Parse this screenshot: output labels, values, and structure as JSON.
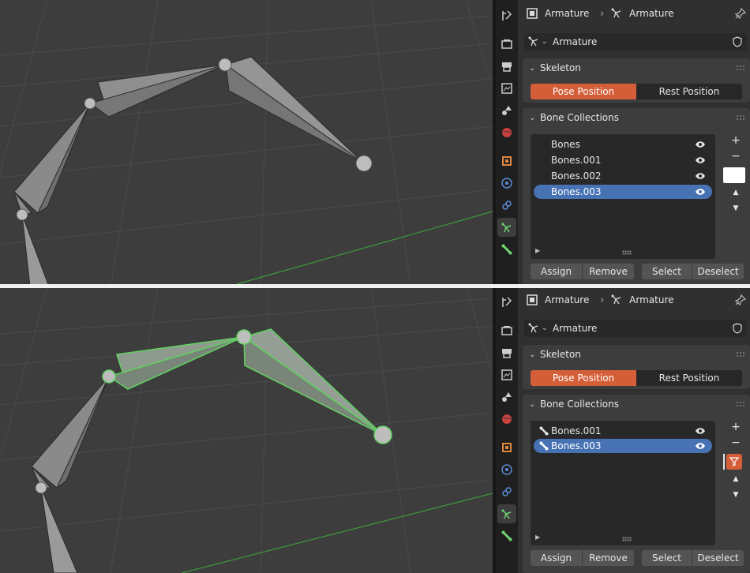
{
  "top": {
    "header": {
      "breadcrumb_object": "Armature",
      "breadcrumb_data": "Armature"
    },
    "datablock": {
      "name": "Armature"
    },
    "skeleton": {
      "title": "Skeleton",
      "pose_position": "Pose Position",
      "rest_position": "Rest Position"
    },
    "bone_collections": {
      "title": "Bone Collections",
      "items": [
        {
          "label": "Bones",
          "selected": false
        },
        {
          "label": "Bones.001",
          "selected": false
        },
        {
          "label": "Bones.002",
          "selected": false
        },
        {
          "label": "Bones.003",
          "selected": true
        }
      ],
      "add": "+",
      "remove": "−",
      "up": "▲",
      "down": "▼"
    },
    "buttons": {
      "assign": "Assign",
      "remove": "Remove",
      "select": "Select",
      "deselect": "Deselect"
    }
  },
  "bottom": {
    "header": {
      "breadcrumb_object": "Armature",
      "breadcrumb_data": "Armature"
    },
    "datablock": {
      "name": "Armature"
    },
    "skeleton": {
      "title": "Skeleton",
      "pose_position": "Pose Position",
      "rest_position": "Rest Position"
    },
    "bone_collections": {
      "title": "Bone Collections",
      "items": [
        {
          "label": "Bones.001",
          "selected": false
        },
        {
          "label": "Bones.003",
          "selected": true
        }
      ],
      "add": "+",
      "remove": "−",
      "up": "▲",
      "down": "▼"
    },
    "buttons": {
      "assign": "Assign",
      "remove": "Remove",
      "select": "Select",
      "deselect": "Deselect"
    }
  },
  "colors": {
    "accent_orange": "#d35e37",
    "selection_blue": "#4772b3",
    "bone_select_green": "#5fd35f",
    "grid_green": "#3c9a3c"
  },
  "tab_icons": [
    "tool-icon",
    "render-icon",
    "output-icon",
    "view-layer-icon",
    "scene-icon",
    "world-icon",
    "object-icon",
    "physics-icon",
    "constraints-icon",
    "armature-data-icon",
    "bone-icon"
  ]
}
